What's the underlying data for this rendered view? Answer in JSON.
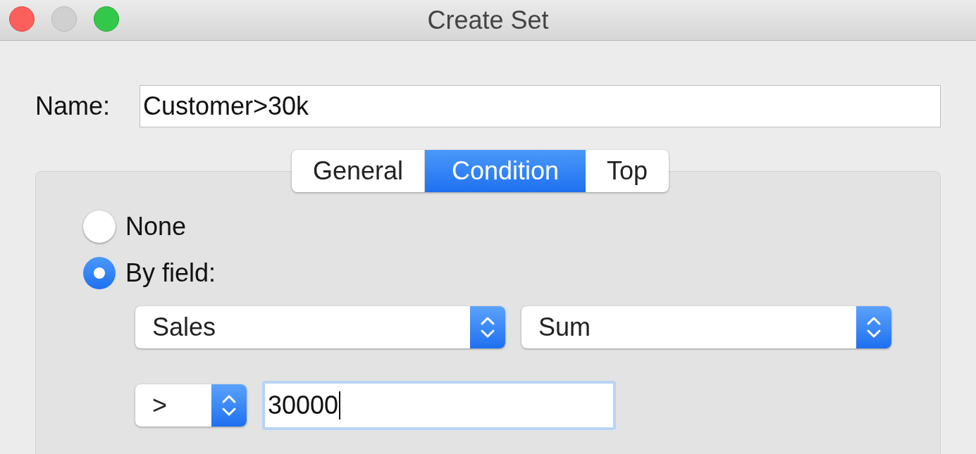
{
  "window": {
    "title": "Create Set"
  },
  "name_field": {
    "label": "Name:",
    "value": "Customer>30k"
  },
  "tabs": [
    {
      "label": "General",
      "selected": false
    },
    {
      "label": "Condition",
      "selected": true
    },
    {
      "label": "Top",
      "selected": false
    }
  ],
  "condition": {
    "options": [
      {
        "label": "None",
        "selected": false
      },
      {
        "label": "By field:",
        "selected": true
      }
    ],
    "field_select": "Sales",
    "aggregation_select": "Sum",
    "operator_select": ">",
    "value_field": "30000"
  }
}
